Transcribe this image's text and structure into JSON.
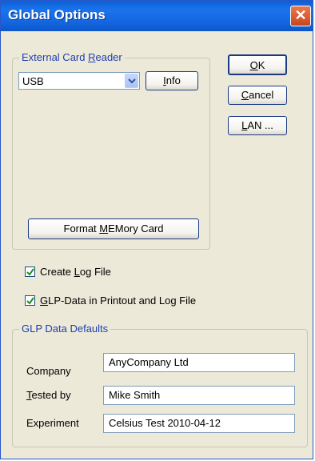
{
  "window": {
    "title": "Global Options",
    "close_glyph": "✕"
  },
  "card_reader": {
    "group_label_pre": "External Card ",
    "group_label_u": "R",
    "group_label_post": "eader",
    "selected_value": "USB",
    "info_pre": "",
    "info_u": "I",
    "info_post": "nfo",
    "format_pre": "Format ",
    "format_u": "M",
    "format_post": "EMory Card"
  },
  "buttons": {
    "ok_pre": "",
    "ok_u": "O",
    "ok_post": "K",
    "cancel_pre": "",
    "cancel_u": "C",
    "cancel_post": "ancel",
    "lan_pre": "",
    "lan_u": "L",
    "lan_post": "AN ..."
  },
  "checkboxes": {
    "log_pre": "Create ",
    "log_u": "L",
    "log_post": "og File",
    "log_checked": true,
    "glp_pre": "",
    "glp_u": "G",
    "glp_post": "LP-Data in Printout and Log File",
    "glp_checked": true
  },
  "glp": {
    "group_label": "GLP Data Defaults",
    "company_label": "Company",
    "company_value": "AnyCompany Ltd",
    "tested_pre": "",
    "tested_u": "T",
    "tested_post": "ested by",
    "tested_value": "Mike Smith",
    "experiment_label": "Experiment",
    "experiment_value": "Celsius Test 2010-04-12"
  },
  "colors": {
    "accent": "#2a57c8",
    "group_label": "#1f3fb0",
    "checkmark": "#1f8a1f"
  },
  "icons": [
    "close-icon",
    "chevron-down-icon",
    "checkmark-icon"
  ]
}
